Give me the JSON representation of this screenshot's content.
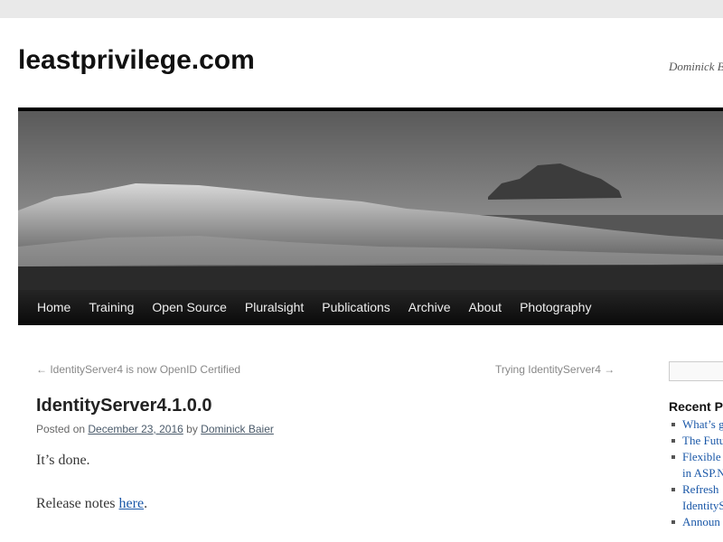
{
  "site": {
    "title": "leastprivilege.com",
    "description": "Dominick B Control"
  },
  "nav": {
    "items": [
      "Home",
      "Training",
      "Open Source",
      "Pluralsight",
      "Publications",
      "Archive",
      "About",
      "Photography"
    ]
  },
  "post_nav": {
    "previous": "← IdentityServer4 is now OpenID Certified",
    "next": "Trying IdentityServer4 →"
  },
  "post": {
    "title": "IdentityServer4.1.0.0",
    "meta_posted_on": "Posted on",
    "meta_date": "December 23, 2016",
    "meta_by": "by",
    "meta_author": "Dominick Baier",
    "p1": "It’s done.",
    "p2_prefix": "Release notes",
    "p2_link": "here",
    "p2_suffix": "."
  },
  "sidebar": {
    "recent_title": "Recent P",
    "recent_items": [
      [
        "What’s g"
      ],
      [
        "The Futu"
      ],
      [
        "Flexible",
        "in ASP.N"
      ],
      [
        "Refresh",
        "IdentityS"
      ],
      [
        "Announ"
      ]
    ]
  },
  "colors": {
    "nav_bg": "#0a0a0a",
    "link": "#1b58a8",
    "page_bg": "#ffffff",
    "outer_bg": "#e9e9e9"
  }
}
